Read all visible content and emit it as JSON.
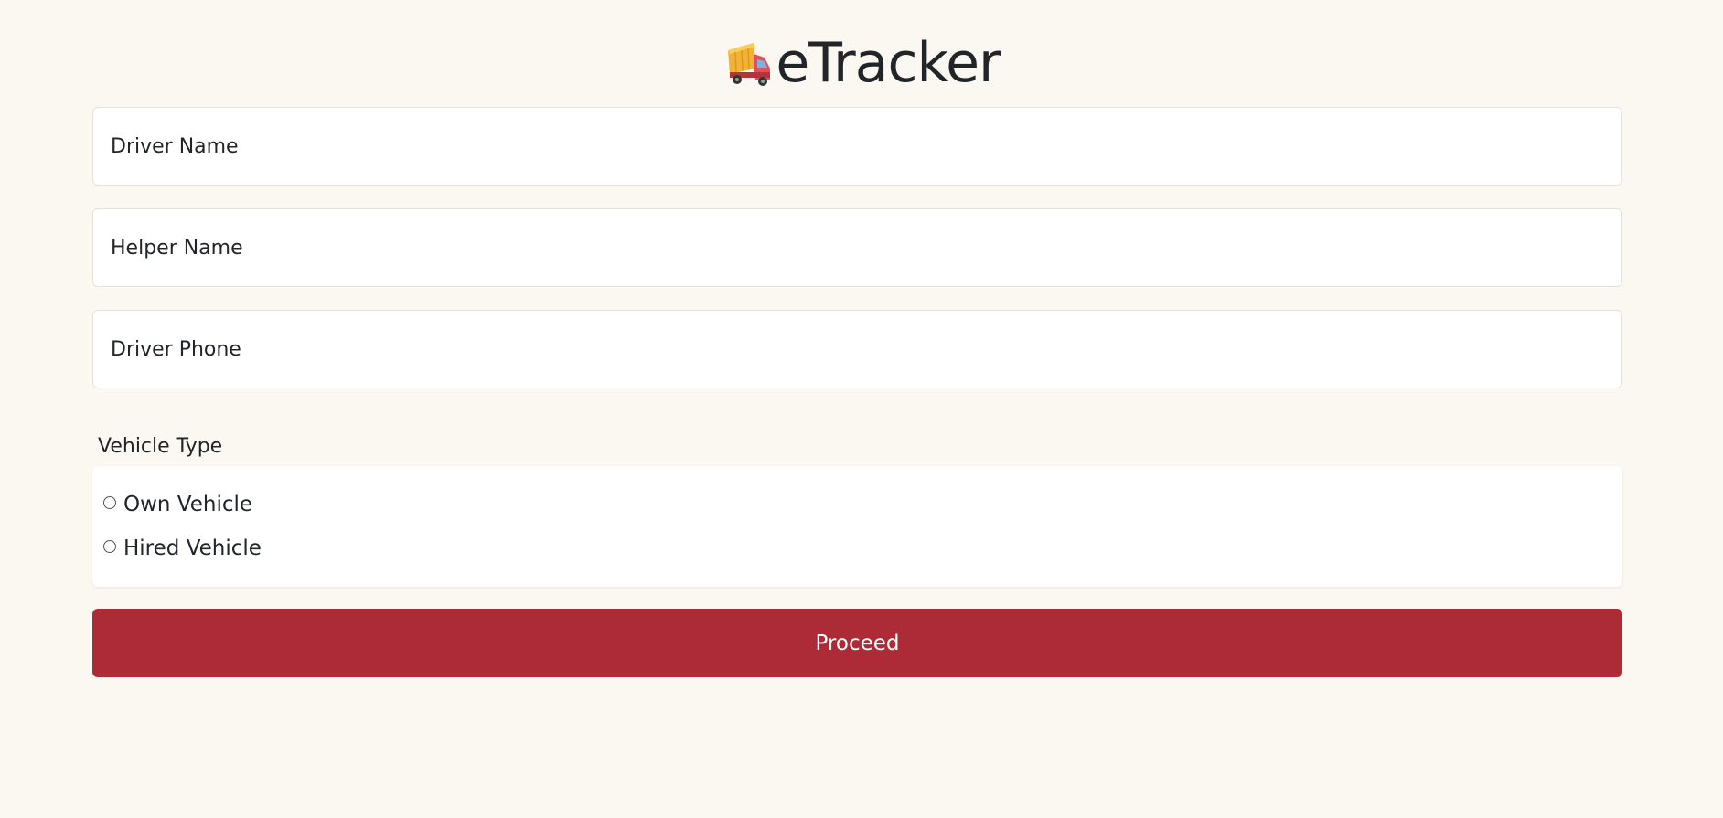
{
  "header": {
    "icon": "truck-icon",
    "title": "eTracker"
  },
  "form": {
    "driver_name": {
      "placeholder": "Driver Name",
      "value": ""
    },
    "helper_name": {
      "placeholder": "Helper Name",
      "value": ""
    },
    "driver_phone": {
      "placeholder": "Driver Phone",
      "value": ""
    },
    "vehicle_type": {
      "label": "Vehicle Type",
      "options": [
        {
          "label": "Own Vehicle",
          "selected": false
        },
        {
          "label": "Hired Vehicle",
          "selected": false
        }
      ]
    },
    "proceed_label": "Proceed"
  },
  "colors": {
    "background": "#fbf8f1",
    "button": "#ad2b37",
    "text": "#212529"
  }
}
